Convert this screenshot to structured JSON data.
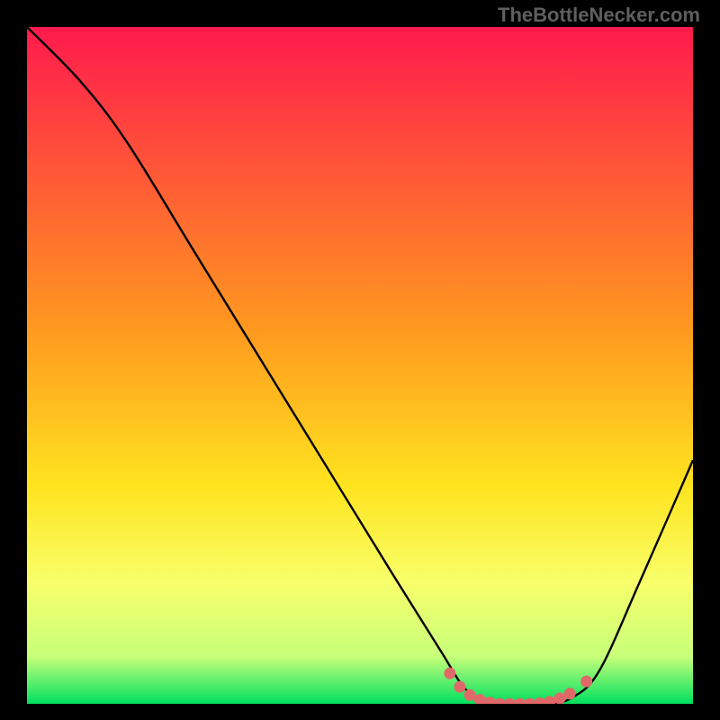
{
  "watermark": "TheBottleNecker.com",
  "chart_data": {
    "type": "line",
    "title": "",
    "xlabel": "",
    "ylabel": "",
    "xlim": [
      0,
      100
    ],
    "ylim": [
      0,
      100
    ],
    "gradient_stops": [
      {
        "offset": 0,
        "color": "#ff1a4d"
      },
      {
        "offset": 45,
        "color": "#ff9a1f"
      },
      {
        "offset": 68,
        "color": "#ffe41f"
      },
      {
        "offset": 82,
        "color": "#f8ff6a"
      },
      {
        "offset": 93,
        "color": "#c8ff7a"
      },
      {
        "offset": 100,
        "color": "#00e060"
      }
    ],
    "series": [
      {
        "name": "bottleneck-curve",
        "color": "#000000",
        "points": [
          {
            "x": 0,
            "y": 100
          },
          {
            "x": 8,
            "y": 92
          },
          {
            "x": 15,
            "y": 83
          },
          {
            "x": 25,
            "y": 67
          },
          {
            "x": 35,
            "y": 51
          },
          {
            "x": 45,
            "y": 35
          },
          {
            "x": 55,
            "y": 19
          },
          {
            "x": 62,
            "y": 8
          },
          {
            "x": 66,
            "y": 2
          },
          {
            "x": 70,
            "y": 0
          },
          {
            "x": 78,
            "y": 0
          },
          {
            "x": 82,
            "y": 1
          },
          {
            "x": 86,
            "y": 5
          },
          {
            "x": 92,
            "y": 18
          },
          {
            "x": 100,
            "y": 36
          }
        ]
      }
    ],
    "markers": {
      "name": "bottom-markers",
      "color": "#e06868",
      "points": [
        {
          "x": 63.5,
          "y": 4.5
        },
        {
          "x": 65.0,
          "y": 2.5
        },
        {
          "x": 66.5,
          "y": 1.3
        },
        {
          "x": 68.0,
          "y": 0.6
        },
        {
          "x": 69.5,
          "y": 0.2
        },
        {
          "x": 71.0,
          "y": 0.0
        },
        {
          "x": 72.5,
          "y": 0.0
        },
        {
          "x": 74.0,
          "y": 0.0
        },
        {
          "x": 75.5,
          "y": 0.0
        },
        {
          "x": 77.0,
          "y": 0.1
        },
        {
          "x": 78.5,
          "y": 0.3
        },
        {
          "x": 80.0,
          "y": 0.8
        },
        {
          "x": 81.5,
          "y": 1.5
        },
        {
          "x": 84.0,
          "y": 3.3
        }
      ]
    }
  }
}
